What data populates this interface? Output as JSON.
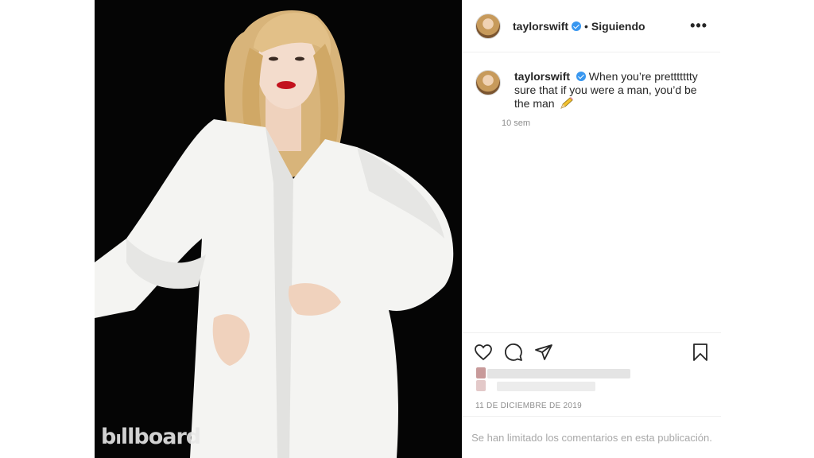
{
  "post": {
    "username": "taylorswift",
    "follow_status": "Siguiendo",
    "separator": "•",
    "more_label": "•••",
    "watermark": "billboard",
    "caption": {
      "username": "taylorswift",
      "text": "When you’re prettttttty sure that if you were a man, you’d be the man",
      "emoji_icon": "pencil-emoji"
    },
    "time_ago": "10 sem",
    "date": "11 DE DICIEMBRE DE 2019",
    "comments_limited": "Se han limitado los comentarios en esta publicación.",
    "colors": {
      "verified": "#3897f0",
      "border": "#dbdbdb",
      "muted": "#8e8e8e",
      "photo_background": "#050505"
    }
  },
  "icons": {
    "like": "heart-icon",
    "comment": "comment-icon",
    "share": "paper-plane-icon",
    "save": "bookmark-icon",
    "verified": "verified-badge-icon"
  }
}
